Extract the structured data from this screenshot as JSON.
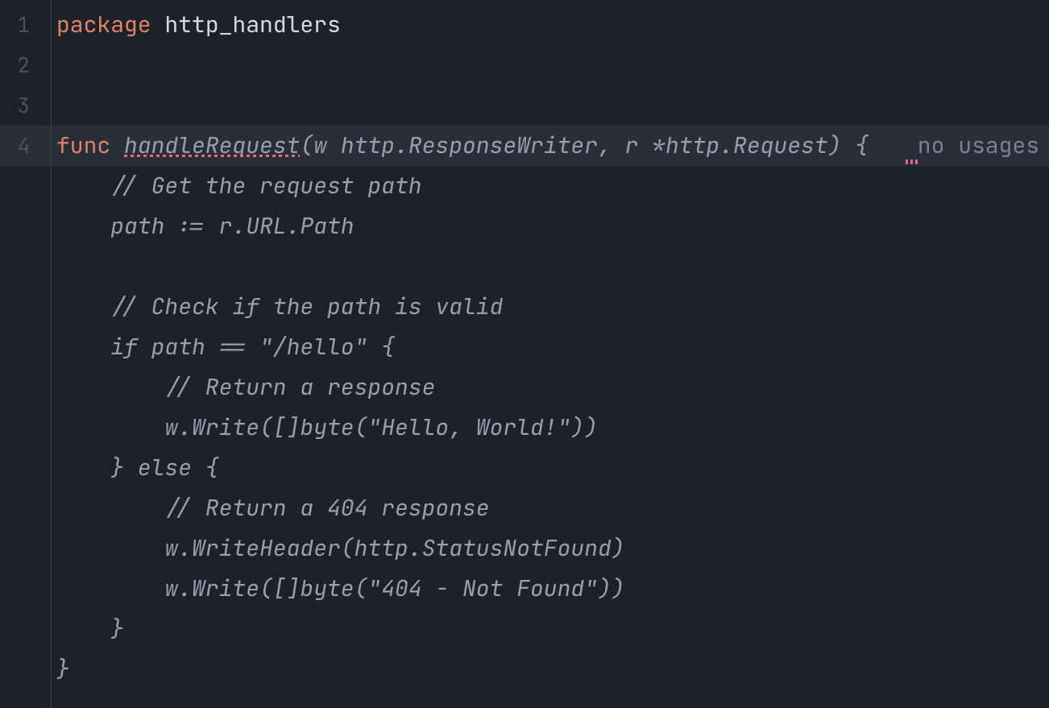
{
  "gutter": {
    "lines": [
      "1",
      "2",
      "3",
      "4"
    ],
    "active_index": 3
  },
  "hints": {
    "no_usages": "no usages"
  },
  "code": {
    "line1_kw": "package",
    "line1_pkg": "http_handlers",
    "func_kw": "func",
    "func_name": "handleRequest",
    "func_sig_rest": "(w http.ResponseWriter, r *http.Request) {",
    "body1": "    // Get the request path",
    "body2": "    path := r.URL.Path",
    "body3": "",
    "body4": "    // Check if the path is valid",
    "body5": "    if path == \"/hello\" {",
    "body6": "        // Return a response",
    "body7": "        w.Write([]byte(\"Hello, World!\"))",
    "body8": "    } else {",
    "body9": "        // Return a 404 response",
    "body10": "        w.WriteHeader(http.StatusNotFound)",
    "body11": "        w.Write([]byte(\"404 - Not Found\"))",
    "body12": "    }",
    "body13": "}"
  }
}
